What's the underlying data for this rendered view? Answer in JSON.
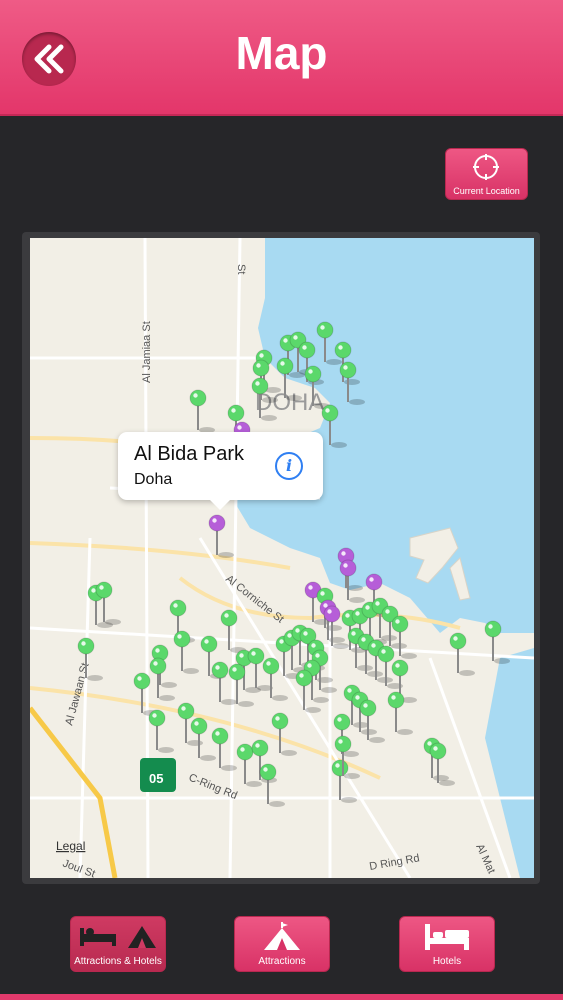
{
  "header": {
    "title": "Map",
    "back_icon": "double-chevron-left-icon"
  },
  "current_location": {
    "label": "Current Location",
    "icon": "crosshair-icon"
  },
  "map": {
    "city_label": "DOHA",
    "streets": [
      "Al Jamiaa St",
      "Al Jawaan St",
      "Al Corniche St",
      "C-Ring Rd",
      "D Ring Rd",
      "Al Mat",
      "Joul St",
      "St"
    ],
    "legal_label": "Legal",
    "route_shield": "05",
    "callout": {
      "title": "Al Bida Park",
      "subtitle": "Doha"
    },
    "colors": {
      "water": "#a8daf2",
      "land": "#f2efe6",
      "pin_green": "#5bd86b",
      "pin_purple": "#b65ed8"
    }
  },
  "tabs": [
    {
      "label": "Attractions & Hotels",
      "icon": "bed-and-tent-icon"
    },
    {
      "label": "Attractions",
      "icon": "tent-icon"
    },
    {
      "label": "Hotels",
      "icon": "bed-icon"
    }
  ]
}
